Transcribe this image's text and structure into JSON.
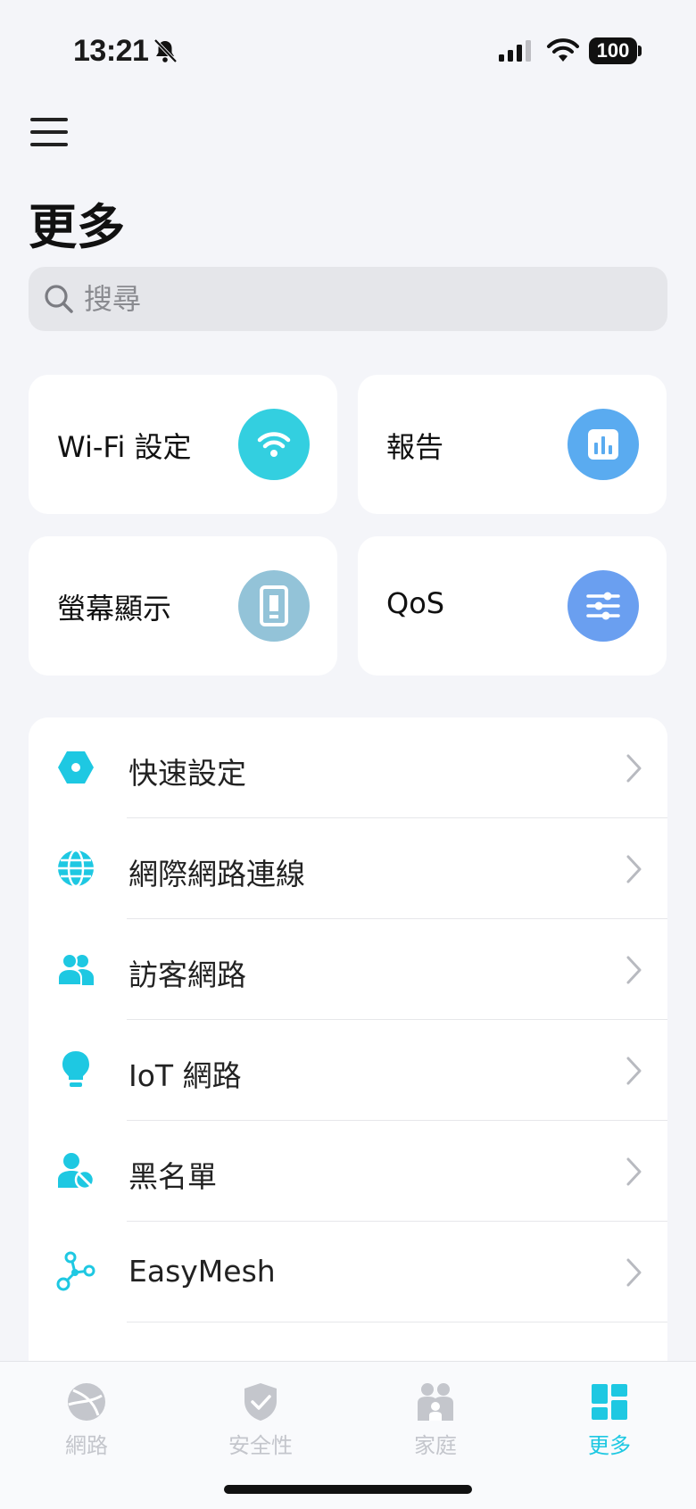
{
  "status_bar": {
    "time": "13:21",
    "battery": "100"
  },
  "header": {
    "title": "更多"
  },
  "search": {
    "placeholder": "搜尋"
  },
  "cards": [
    {
      "label": "Wi-Fi 設定",
      "icon": "wifi-icon",
      "color": "#33cfe0"
    },
    {
      "label": "報告",
      "icon": "bar-chart-icon",
      "color": "#5aabf0"
    },
    {
      "label": "螢幕顯示",
      "icon": "display-panel-icon",
      "color": "#93c3d8"
    },
    {
      "label": "QoS",
      "icon": "sliders-icon",
      "color": "#6a9ff0"
    }
  ],
  "list": {
    "items": [
      {
        "label": "快速設定",
        "icon": "hexagon-setup-icon"
      },
      {
        "label": "網際網路連線",
        "icon": "globe-icon"
      },
      {
        "label": "訪客網路",
        "icon": "guests-icon"
      },
      {
        "label": "IoT 網路",
        "icon": "lightbulb-icon"
      },
      {
        "label": "黑名單",
        "icon": "user-blocked-icon"
      },
      {
        "label": "EasyMesh",
        "icon": "mesh-nodes-icon"
      }
    ]
  },
  "tab_bar": {
    "tabs": [
      {
        "label": "網路",
        "icon": "globe-icon",
        "active": false
      },
      {
        "label": "安全性",
        "icon": "shield-check-icon",
        "active": false
      },
      {
        "label": "家庭",
        "icon": "family-icon",
        "active": false
      },
      {
        "label": "更多",
        "icon": "grid-more-icon",
        "active": true
      }
    ]
  },
  "colors": {
    "accent": "#1ec8e2",
    "background": "#f4f5f9",
    "inactive": "#c4c6cc"
  }
}
